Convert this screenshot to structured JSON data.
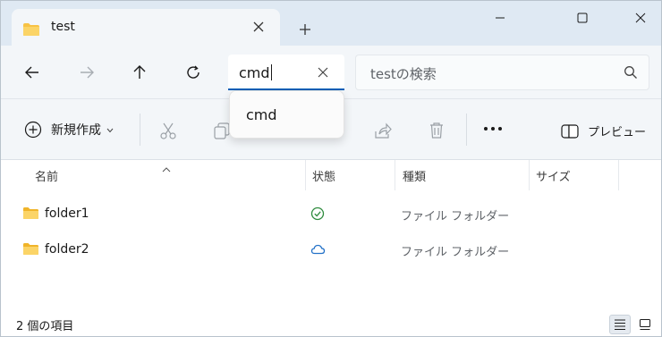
{
  "window": {
    "tab_title": "test"
  },
  "navigation": {
    "address_value": "cmd",
    "search_placeholder": "testの検索"
  },
  "suggestion": {
    "item": "cmd"
  },
  "commandbar": {
    "new_label": "新規作成",
    "preview_label": "プレビュー"
  },
  "columns": {
    "name": "名前",
    "status": "状態",
    "type": "種類",
    "size": "サイズ"
  },
  "rows": [
    {
      "name": "folder1",
      "status_icon": "check-circle-icon",
      "type": "ファイル フォルダー"
    },
    {
      "name": "folder2",
      "status_icon": "cloud-icon",
      "type": "ファイル フォルダー"
    }
  ],
  "statusbar": {
    "item_count": "2 個の項目"
  },
  "colors": {
    "accent": "#005fb8",
    "folder": "#f7c245",
    "status_green": "#2e8b3e",
    "status_blue": "#2472c8"
  }
}
